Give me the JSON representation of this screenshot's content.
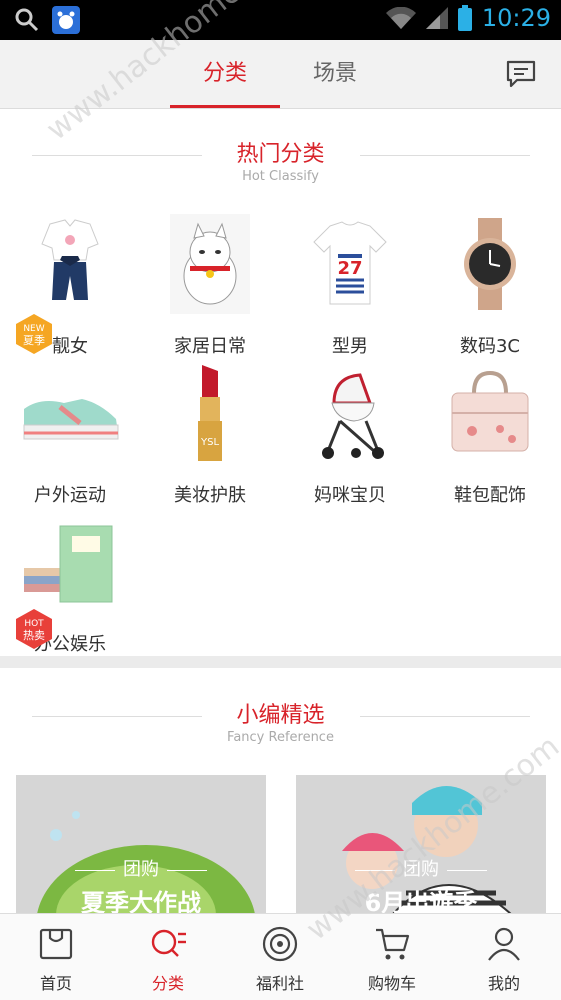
{
  "status": {
    "time": "10:29"
  },
  "tabs": [
    {
      "label": "分类"
    },
    {
      "label": "场景"
    }
  ],
  "hot": {
    "title": "热门分类",
    "subtitle": "Hot Classify",
    "categories": [
      {
        "label": "靓女",
        "badge_top": "NEW",
        "badge_bottom": "夏季"
      },
      {
        "label": "家居日常"
      },
      {
        "label": "型男"
      },
      {
        "label": "数码3C"
      },
      {
        "label": "户外运动"
      },
      {
        "label": "美妆护肤"
      },
      {
        "label": "妈咪宝贝"
      },
      {
        "label": "鞋包配饰"
      },
      {
        "label": "办公娱乐",
        "badge_top": "HOT",
        "badge_bottom": "热卖"
      }
    ]
  },
  "picks": {
    "title": "小编精选",
    "subtitle": "Fancy Reference",
    "cards": [
      {
        "tag": "团购",
        "title": "夏季大作战"
      },
      {
        "tag": "团购",
        "title": "6月出遊季"
      }
    ]
  },
  "watermark": "www.hackhome.com",
  "bottom_nav": [
    {
      "label": "首页"
    },
    {
      "label": "分类"
    },
    {
      "label": "福利社"
    },
    {
      "label": "购物车"
    },
    {
      "label": "我的"
    }
  ],
  "colors": {
    "accent": "#d8232a",
    "status_icon": "#2bb0e6",
    "new_badge": "#f5a623",
    "hot_badge": "#e8403a"
  }
}
